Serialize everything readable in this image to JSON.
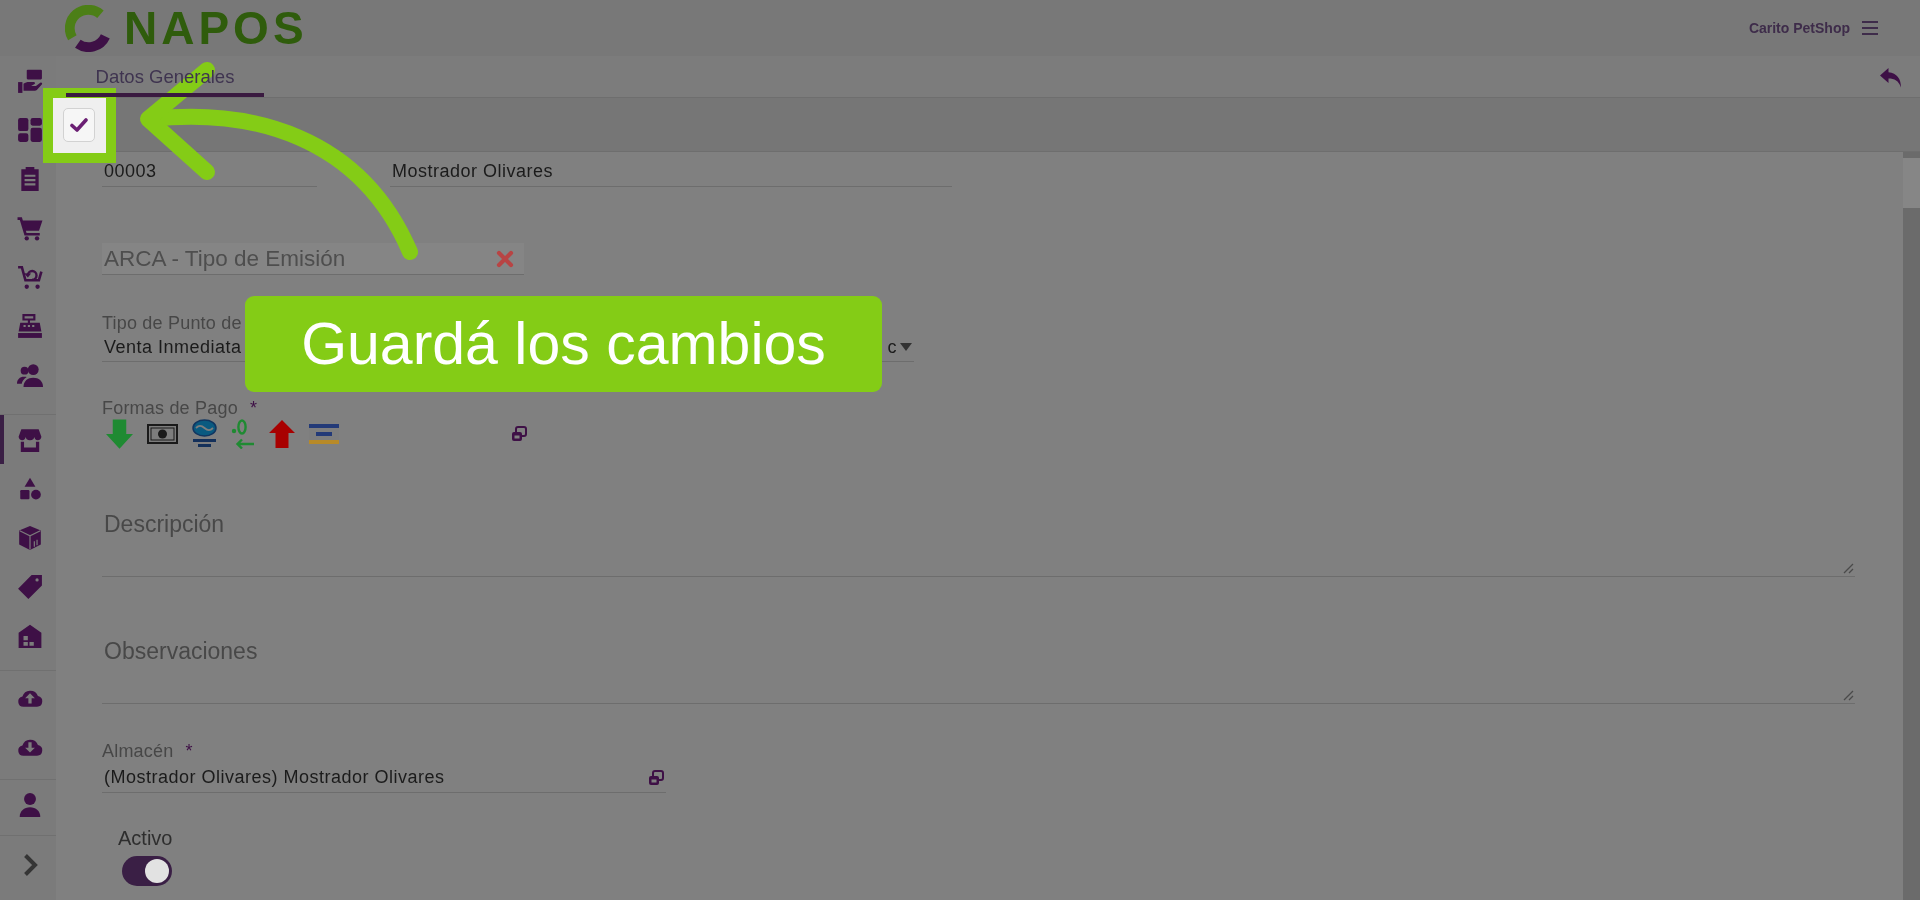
{
  "header": {
    "logo": "NAPOS",
    "account": "Carito PetShop"
  },
  "sidebar": {
    "groups": [
      {
        "items": [
          {
            "selected": false
          },
          {
            "selected": false
          },
          {
            "selected": false
          },
          {
            "selected": false
          },
          {
            "selected": false
          },
          {
            "selected": false
          },
          {
            "selected": false
          }
        ]
      },
      {
        "items": [
          {
            "selected": true
          },
          {
            "selected": false
          },
          {
            "selected": false
          },
          {
            "selected": false
          },
          {
            "selected": false
          }
        ]
      },
      {
        "items": [
          {
            "selected": false
          },
          {
            "selected": false
          }
        ]
      },
      {
        "items": [
          {
            "selected": false
          }
        ]
      }
    ]
  },
  "tabs": [
    {
      "label": "Datos Generales",
      "selected": true
    }
  ],
  "form": {
    "code": {
      "value": "00003"
    },
    "name": {
      "value": "Mostrador Olivares"
    },
    "emission_type": {
      "placeholder": "ARCA - Tipo de Emisión"
    },
    "point_type": {
      "label": "Tipo de Punto de",
      "value": "Venta Inmediata",
      "value_tail": "c"
    },
    "payment_methods": {
      "label": "Formas de Pago",
      "required_mark": "*"
    },
    "description": {
      "placeholder": "Descripción"
    },
    "observations": {
      "placeholder": "Observaciones"
    },
    "warehouse": {
      "label": "Almacén",
      "required_mark": "*",
      "value": "(Mostrador Olivares) Mostrador Olivares"
    },
    "active": {
      "label": "Activo",
      "on": true
    }
  },
  "guide": {
    "callout": "Guardá los cambios"
  }
}
